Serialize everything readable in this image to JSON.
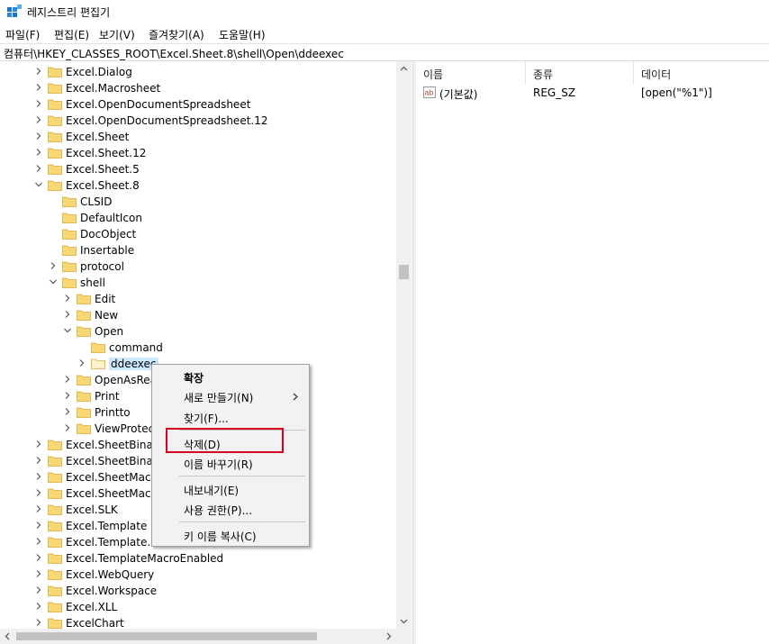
{
  "window": {
    "title": "레지스트리 편집기"
  },
  "menu": [
    "파일(F)",
    "편집(E)",
    "보기(V)",
    "즐겨찾기(A)",
    "도움말(H)"
  ],
  "address": "컴퓨터\\HKEY_CLASSES_ROOT\\Excel.Sheet.8\\shell\\Open\\ddeexec",
  "tree": [
    {
      "label": "Excel.Dialog",
      "chevron": "right"
    },
    {
      "label": "Excel.Macrosheet",
      "chevron": "right"
    },
    {
      "label": "Excel.OpenDocumentSpreadsheet",
      "chevron": "right"
    },
    {
      "label": "Excel.OpenDocumentSpreadsheet.12",
      "chevron": "right"
    },
    {
      "label": "Excel.Sheet",
      "chevron": "right"
    },
    {
      "label": "Excel.Sheet.12",
      "chevron": "right"
    },
    {
      "label": "Excel.Sheet.5",
      "chevron": "right"
    },
    {
      "label": "Excel.Sheet.8",
      "chevron": "down"
    },
    {
      "label": "CLSID",
      "chevron": "none"
    },
    {
      "label": "DefaultIcon",
      "chevron": "none"
    },
    {
      "label": "DocObject",
      "chevron": "none"
    },
    {
      "label": "Insertable",
      "chevron": "none"
    },
    {
      "label": "protocol",
      "chevron": "right"
    },
    {
      "label": "shell",
      "chevron": "down"
    },
    {
      "label": "Edit",
      "chevron": "right"
    },
    {
      "label": "New",
      "chevron": "right"
    },
    {
      "label": "Open",
      "chevron": "down"
    },
    {
      "label": "command",
      "chevron": "none"
    },
    {
      "label": "ddeexec",
      "chevron": "right",
      "selected": true
    },
    {
      "label": "OpenAsReadOnly",
      "chevron": "right"
    },
    {
      "label": "Print",
      "chevron": "right"
    },
    {
      "label": "Printto",
      "chevron": "right"
    },
    {
      "label": "ViewProtected",
      "chevron": "right"
    },
    {
      "label": "Excel.SheetBinaryMacroEnabled",
      "chevron": "right"
    },
    {
      "label": "Excel.SheetBinaryMacroEnabled.12",
      "chevron": "right"
    },
    {
      "label": "Excel.SheetMacroEnabled",
      "chevron": "right"
    },
    {
      "label": "Excel.SheetMacroEnabled.12",
      "chevron": "right"
    },
    {
      "label": "Excel.SLK",
      "chevron": "right"
    },
    {
      "label": "Excel.Template",
      "chevron": "right"
    },
    {
      "label": "Excel.Template.8",
      "chevron": "right"
    },
    {
      "label": "Excel.TemplateMacroEnabled",
      "chevron": "right"
    },
    {
      "label": "Excel.WebQuery",
      "chevron": "right"
    },
    {
      "label": "Excel.Workspace",
      "chevron": "right"
    },
    {
      "label": "Excel.XLL",
      "chevron": "right"
    },
    {
      "label": "ExcelChart",
      "chevron": "right"
    }
  ],
  "list": {
    "columns": [
      "이름",
      "종류",
      "데이터"
    ],
    "rows": [
      {
        "name": "(기본값)",
        "type": "REG_SZ",
        "data": "[open(\"%1\")]"
      }
    ]
  },
  "context_menu": {
    "expand": "확장",
    "new": "새로 만들기(N)",
    "find": "찾기(F)...",
    "delete": "삭제(D)",
    "rename": "이름 바꾸기(R)",
    "export": "내보내기(E)",
    "permissions": "사용 권한(P)...",
    "copy_key_name": "키 이름 복사(C)"
  },
  "colors": {
    "highlight_box": "#d9001b",
    "selection": "#cce8ff",
    "folder": "#f8d775"
  }
}
